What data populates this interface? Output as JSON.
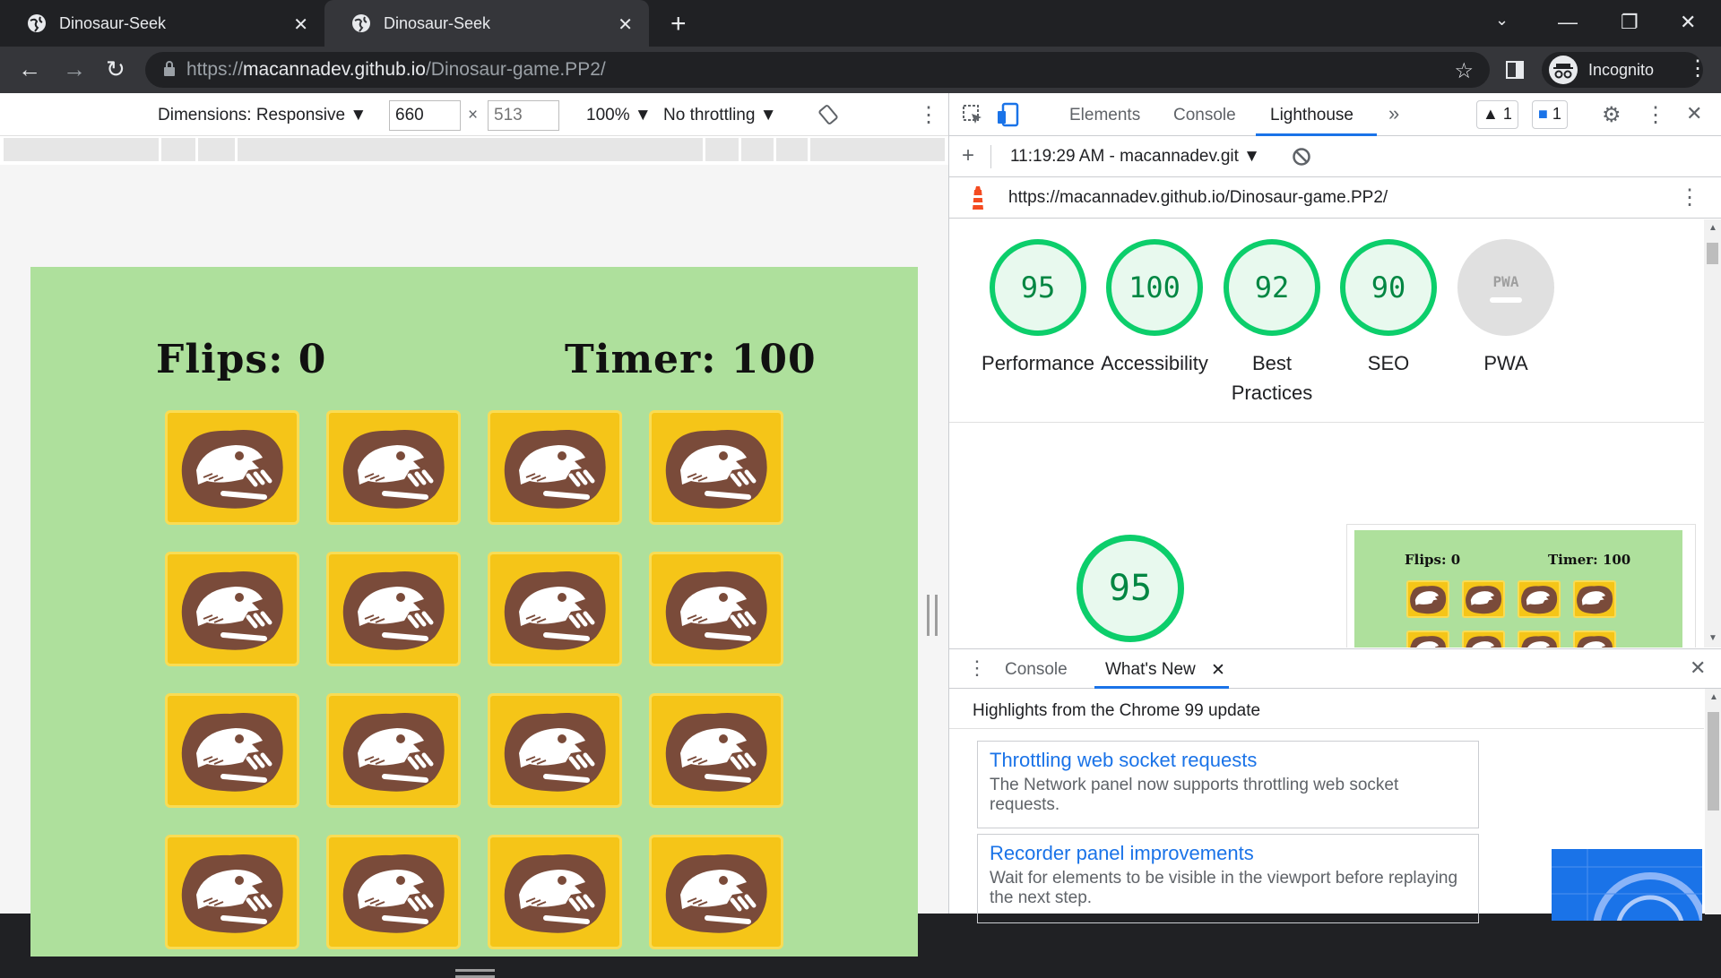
{
  "browser": {
    "tabs": [
      {
        "title": "Dinosaur-Seek"
      },
      {
        "title": "Dinosaur-Seek"
      }
    ],
    "url_prefix": "https://",
    "url_host": "macannadev.github.io",
    "url_path": "/Dinosaur-game.PP2/",
    "profile_label": "Incognito"
  },
  "device_toolbar": {
    "dimensions_label": "Dimensions: Responsive",
    "width": "660",
    "height_placeholder": "513",
    "times": "×",
    "zoom": "100%",
    "throttling": "No throttling"
  },
  "game": {
    "flips_label": "Flips: 0",
    "timer_label": "Timer: 100",
    "card_count": 16
  },
  "devtools": {
    "tabs": [
      "Elements",
      "Console",
      "Lighthouse"
    ],
    "active_tab": "Lighthouse",
    "more": "»",
    "warnings_count": "1",
    "messages_count": "1",
    "report_selector": "11:19:29 AM - macannadev.git",
    "report_url": "https://macannadev.github.io/Dinosaur-game.PP2/",
    "scores": [
      {
        "value": "95",
        "label": "Performance"
      },
      {
        "value": "100",
        "label": "Accessibility"
      },
      {
        "value": "92",
        "label": "Best Practices"
      },
      {
        "value": "90",
        "label": "SEO"
      },
      {
        "value": "PWA",
        "label": "PWA"
      }
    ],
    "main_score": "95",
    "thumb_flips": "Flips: 0",
    "thumb_timer": "Timer: 100"
  },
  "drawer": {
    "tabs": [
      "Console",
      "What's New"
    ],
    "active_tab": "What's New",
    "highlights": "Highlights from the Chrome 99 update",
    "news": [
      {
        "title": "Throttling web socket requests",
        "desc": "The Network panel now supports throttling web socket requests."
      },
      {
        "title": "Recorder panel improvements",
        "desc": "Wait for elements to be visible in the viewport before replaying the next step."
      }
    ]
  }
}
